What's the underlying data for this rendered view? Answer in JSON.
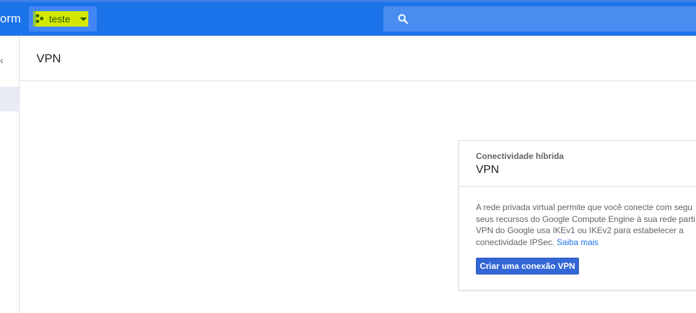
{
  "topbar": {
    "brand_fragment": "orm",
    "project_name": "teste",
    "search_placeholder": ""
  },
  "header": {
    "title": "VPN"
  },
  "card": {
    "subtitle": "Conectividade híbrida",
    "title": "VPN",
    "description_lines": [
      "A rede privada virtual permite que você conecte com segu",
      "seus recursos do Google Compute Engine à sua rede parti",
      "VPN do Google usa IKEv1 ou IKEv2 para estabelecer a",
      "conectividade IPSec."
    ],
    "learn_more": "Saiba mais",
    "button_label": "Criar uma conexão VPN"
  },
  "colors": {
    "topbar": "#1a73e8",
    "project_highlight": "#d4e800",
    "link": "#1a73e8",
    "button": "#3367d6"
  },
  "icons": [
    "search-icon",
    "chevron-left-icon",
    "project-dots-icon",
    "caret-down-icon"
  ]
}
